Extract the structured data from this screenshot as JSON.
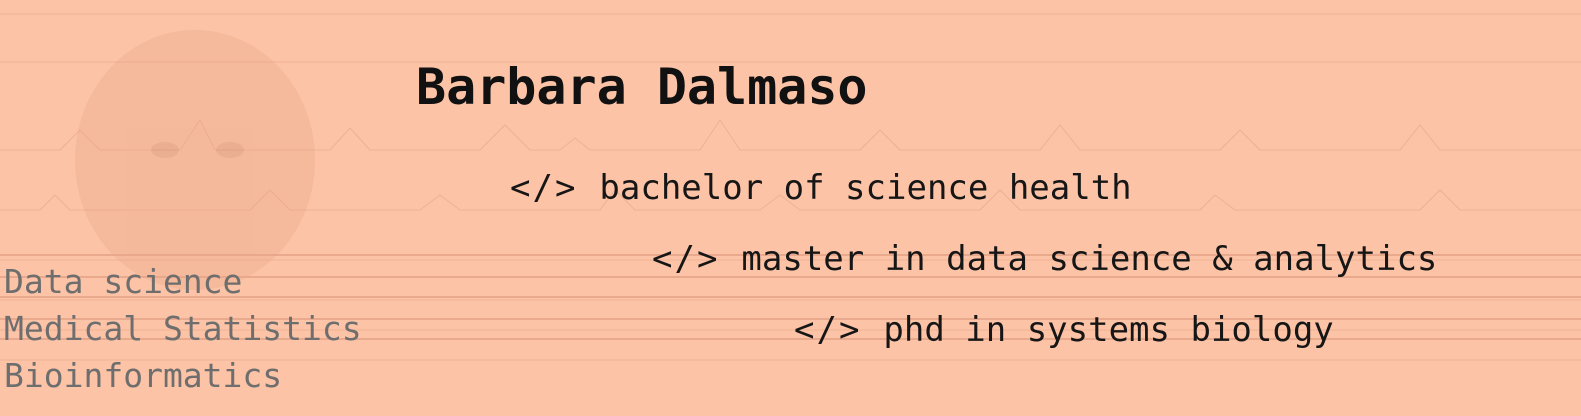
{
  "header": {
    "name": "Barbara Dalmaso"
  },
  "degrees": [
    {
      "icon": "code-icon",
      "tag": "</>",
      "label": "bachelor of science health"
    },
    {
      "icon": "code-icon",
      "tag": "</>",
      "label": "master in data science & analytics"
    },
    {
      "icon": "code-icon",
      "tag": "</>",
      "label": "phd in systems biology"
    }
  ],
  "skills": [
    "Data science",
    "Medical Statistics",
    "Bioinformatics"
  ],
  "colors": {
    "background": "#fcc3a6",
    "name_text": "#111111",
    "degree_text": "#161616",
    "skills_text": "#6e6e6e"
  }
}
